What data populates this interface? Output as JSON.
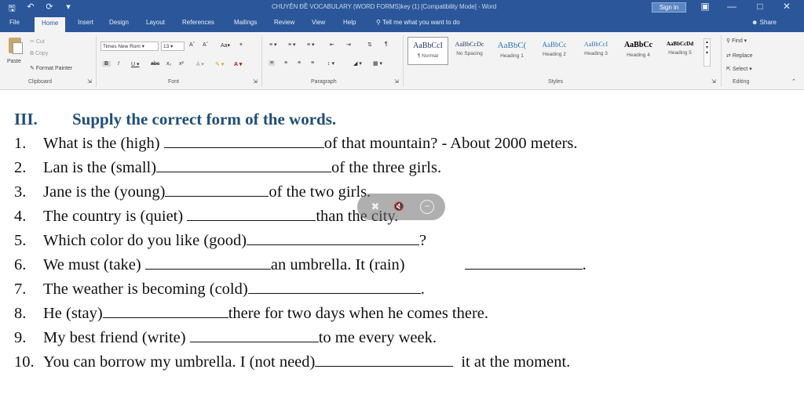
{
  "window": {
    "title": "CHUYÊN ĐỀ VOCABULARY (WORD FORMS)key (1) [Compatibility Mode] - Word",
    "signin_label": "Sign in",
    "qat_icons": [
      "save-icon",
      "undo-icon",
      "redo-icon",
      "customize-icon"
    ]
  },
  "tabs": [
    "File",
    "Home",
    "Insert",
    "Design",
    "Layout",
    "References",
    "Mailings",
    "Review",
    "View",
    "Help"
  ],
  "tell_me": "Tell me what you want to do",
  "share": "Share",
  "ribbon": {
    "clipboard": {
      "paste": "Paste",
      "cut": "Cut",
      "copy": "Copy",
      "format_painter": "Format Painter",
      "label": "Clipboard"
    },
    "font": {
      "name": "Times New Rom",
      "size": "13",
      "label": "Font"
    },
    "paragraph": {
      "label": "Paragraph"
    },
    "styles": {
      "label": "Styles",
      "items": [
        {
          "sample": "AaBbCcI",
          "name": "¶ Normal"
        },
        {
          "sample": "AaBbCcDc",
          "name": "No Spacing"
        },
        {
          "sample": "AaBbC(",
          "name": "Heading 1"
        },
        {
          "sample": "AaBbCc",
          "name": "Heading 2"
        },
        {
          "sample": "AaBbCcI",
          "name": "Heading 3"
        },
        {
          "sample": "AaBbCc",
          "name": "Heading 4"
        },
        {
          "sample": "AaBbCcDd",
          "name": "Heading 5"
        }
      ]
    },
    "editing": {
      "find": "Find",
      "replace": "Replace",
      "select": "Select",
      "label": "Editing"
    }
  },
  "document": {
    "heading_num": "III.",
    "heading_text": "Supply the correct form of the words.",
    "questions": [
      {
        "n": "1.",
        "before": "What is the (high)",
        "after": "of that mountain? - About 2000 meters."
      },
      {
        "n": "2.",
        "before": "Lan is the (small)",
        "after": "of the three girls."
      },
      {
        "n": "3.",
        "before": "Jane is the (young)",
        "after": "of the two girls."
      },
      {
        "n": "4.",
        "before": "The country is (quiet)",
        "after": "than the city."
      },
      {
        "n": "5.",
        "before": "Which color do you like (good)",
        "after": "?"
      },
      {
        "n": "6.",
        "before": "We must (take)",
        "middle": "an umbrella. It (rain)",
        "after": "."
      },
      {
        "n": "7.",
        "before": "The weather is becoming (cold)",
        "after": "."
      },
      {
        "n": "8.",
        "before": "He (stay)",
        "after": "there for two days when he comes there."
      },
      {
        "n": "9.",
        "before": "My best friend (write)",
        "after": "to me every week."
      },
      {
        "n": "10.",
        "before": "You can borrow my umbrella. I (not need)",
        "after": "it at the moment."
      }
    ]
  },
  "overlay": {
    "icons": [
      "pin-icon",
      "mute-icon",
      "close-icon"
    ]
  }
}
